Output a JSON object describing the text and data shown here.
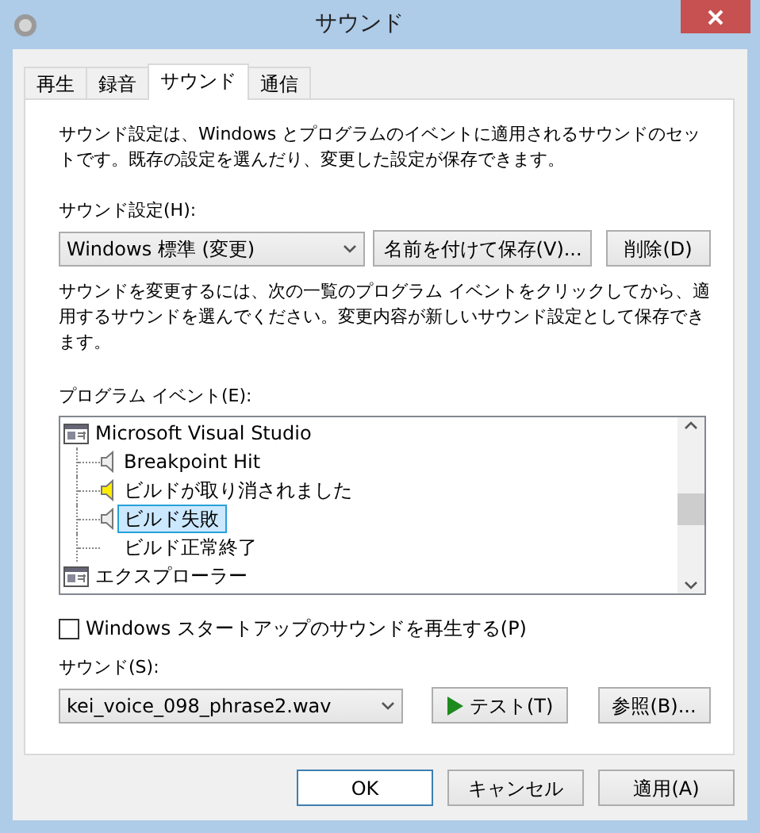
{
  "window": {
    "title": "サウンド"
  },
  "tabs": [
    {
      "label": "再生",
      "selected": false
    },
    {
      "label": "録音",
      "selected": false
    },
    {
      "label": "サウンド",
      "selected": true
    },
    {
      "label": "通信",
      "selected": false
    }
  ],
  "intro": "サウンド設定は、Windows とプログラムのイベントに適用されるサウンドのセットです。既存の設定を選んだり、変更した設定が保存できます。",
  "scheme": {
    "label": "サウンド設定(H):",
    "value": "Windows 標準 (変更)",
    "buttons": [
      "名前を付けて保存(V)...",
      "削除(D)"
    ]
  },
  "hint": "サウンドを変更するには、次の一覧のプログラム イベントをクリックしてから、適用するサウンドを選んでください。変更内容が新しいサウンド設定として保存できます。",
  "events": {
    "label": "プログラム イベント(E):",
    "items": [
      {
        "label": "Microsoft Visual Studio",
        "kind": "app",
        "selected": false,
        "children": [
          {
            "label": "Breakpoint Hit",
            "kind": "event",
            "has_sound": true,
            "modified": false,
            "selected": false
          },
          {
            "label": "ビルドが取り消されました",
            "kind": "event",
            "has_sound": true,
            "modified": true,
            "selected": false
          },
          {
            "label": "ビルド失敗",
            "kind": "event",
            "has_sound": true,
            "modified": false,
            "selected": true
          },
          {
            "label": "ビルド正常終了",
            "kind": "event",
            "has_sound": false,
            "selected": false
          }
        ]
      },
      {
        "label": "エクスプローラー",
        "kind": "app",
        "selected": false
      }
    ]
  },
  "startup": {
    "label": "Windows スタートアップのサウンドを再生する(P)",
    "checked": false
  },
  "sound": {
    "label": "サウンド(S):",
    "value": "kei_voice_098_phrase2.wav",
    "test": "テスト(T)",
    "browse": "参照(B)..."
  },
  "footer": [
    {
      "label": "OK",
      "default": true
    },
    {
      "label": "キャンセル",
      "default": false
    },
    {
      "label": "適用(A)",
      "default": false
    }
  ]
}
